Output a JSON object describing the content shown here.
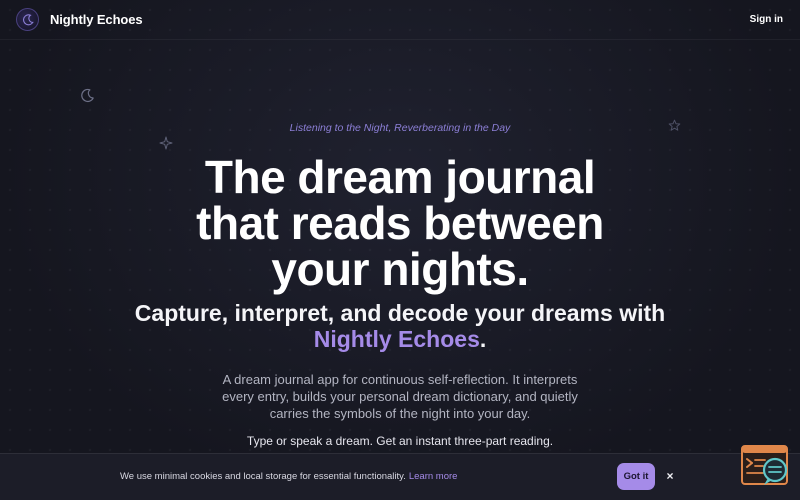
{
  "header": {
    "brand_name": "Nightly Echoes",
    "signin_label": "Sign in"
  },
  "hero": {
    "tagline": "Listening to the Night, Reverberating in the Day",
    "headline_lines": [
      "The dream journal",
      "that reads between",
      "your nights."
    ],
    "subheadline_text": "Capture, interpret, and decode your dreams with",
    "subheadline_accent": "Nightly Echoes",
    "subheadline_end": ".",
    "description": "A dream journal app for continuous self-reflection. It interprets every entry, builds your personal dream dictionary, and quietly carries the symbols of the night into your day.",
    "cta_line": "Type or speak a dream. Get an instant three-part reading."
  },
  "cookie": {
    "text": "We use minimal cookies and local storage for essential functionality.",
    "link_label": "Learn more",
    "accept_label": "Got it",
    "close_glyph": "×"
  },
  "icons": {
    "logo": "moon-logo-icon",
    "deco_moon": "crescent-moon-icon",
    "deco_sparkle": "sparkle-icon",
    "deco_star": "star-icon",
    "help_widget": "chat-assistant-icon"
  },
  "colors": {
    "background": "#15161f",
    "accent": "#a58be8",
    "tagline": "#8c7fd6",
    "widget_orange": "#e0874a",
    "widget_teal": "#5fc7c9"
  }
}
